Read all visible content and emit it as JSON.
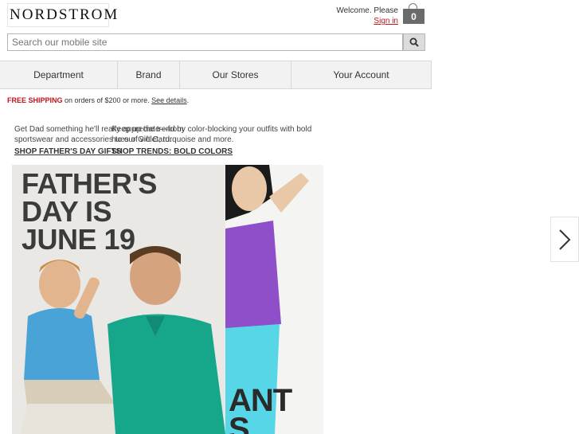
{
  "header": {
    "logo_text": "NORDSTROM",
    "welcome_text": "Welcome. Please",
    "signin_label": "Sign in",
    "bag_count": "0"
  },
  "search": {
    "placeholder": "Search our mobile site"
  },
  "nav": {
    "items": [
      {
        "label": "Department"
      },
      {
        "label": "Brand"
      },
      {
        "label": "Our Stores"
      },
      {
        "label": "Your Account"
      }
    ]
  },
  "shipping": {
    "highlight": "FREE SHIPPING",
    "text": " on orders of $200 or more. ",
    "link": "See details",
    "suffix": "."
  },
  "promos": [
    {
      "text": "Get Dad something he'll really appreciate—from sportswear and accessories to our Gift Card.",
      "link": "SHOP FATHER'S DAY GIFTS",
      "headline_line1": "FATHER'S",
      "headline_line2": "DAY IS",
      "headline_line3": "JUNE 19"
    },
    {
      "text": "Keep up the trend by color-blocking your outfits with bold hues of violet, turquoise and more.",
      "link": "SHOP TRENDS: BOLD COLORS",
      "image_text_line1": "ANT",
      "image_text_line2": "S"
    }
  ],
  "icons": {
    "search": "search-icon",
    "bag": "shopping-bag-icon",
    "next": "chevron-right-icon"
  },
  "colors": {
    "accent_red": "#c0141b",
    "nav_bg": "#f2f2f2"
  }
}
